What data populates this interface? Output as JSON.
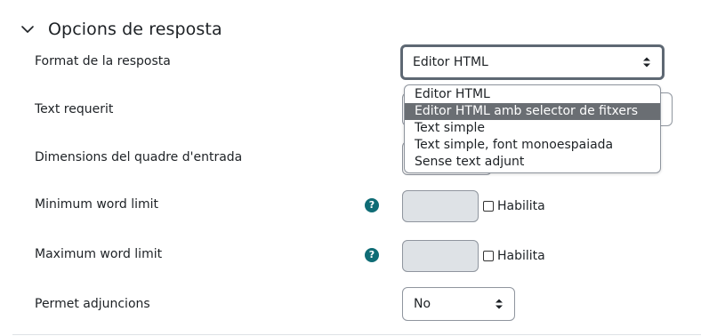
{
  "section": {
    "title": "Opcions de resposta",
    "chevron_icon": "chevron-down-icon"
  },
  "rows": {
    "format": {
      "label": "Format de la resposta",
      "selected": "Editor HTML"
    },
    "required": {
      "label": "Text requerit"
    },
    "dimensions": {
      "label": "Dimensions del quadre d'entrada"
    },
    "min_words": {
      "label": "Minimum word limit",
      "help_icon": "help-icon",
      "checkbox_label": "Habilita"
    },
    "max_words": {
      "label": "Maximum word limit",
      "help_icon": "help-icon",
      "checkbox_label": "Habilita"
    },
    "attachments": {
      "label": "Permet adjuncions",
      "selected": "No"
    }
  },
  "dropdown": {
    "options": [
      "Editor HTML",
      "Editor HTML amb selector de fitxers",
      "Text simple",
      "Text simple, font monoespaiada",
      "Sense text adjunt"
    ],
    "highlighted_index": 1
  },
  "colors": {
    "help_icon_bg": "#0f6c75",
    "highlight_bg": "#6a6e73",
    "disabled_input_bg": "#dee2e6",
    "border": "#8f959e"
  }
}
